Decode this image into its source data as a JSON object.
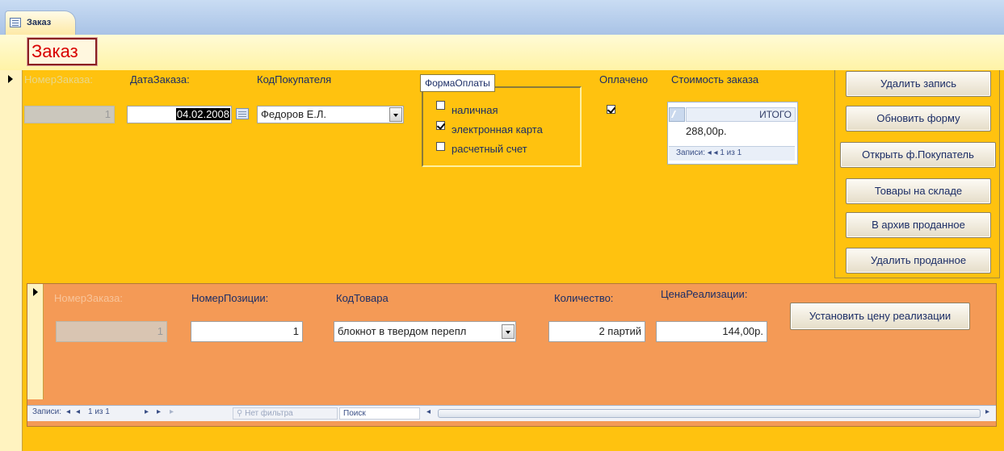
{
  "tab": {
    "label": "Заказ"
  },
  "form": {
    "title": "Заказ"
  },
  "main": {
    "labels": {
      "order_number": "НомерЗаказа:",
      "order_date": "ДатаЗаказа:",
      "customer_code": "КодПокупателя",
      "payment_form": "ФормаОплаты",
      "paid": "Оплачено",
      "order_cost": "Стоимость заказа"
    },
    "values": {
      "order_number": "1",
      "order_date": "04.02.2008",
      "customer": "Федоров Е.Л.",
      "paid": true
    },
    "payment_options": [
      {
        "label": "наличная",
        "checked": false
      },
      {
        "label": "электронная карта",
        "checked": true
      },
      {
        "label": "расчетный счет",
        "checked": false
      }
    ],
    "total_subform": {
      "header": "ИТОГО",
      "value": "288,00р.",
      "nav": "Записи: ◂ ◂ 1 из 1"
    }
  },
  "buttons": {
    "delete_record": "Удалить запись",
    "refresh_form": "Обновить форму",
    "open_customer": "Открыть ф.Покупатель",
    "warehouse": "Товары на складе",
    "archive_sold": "В архив проданное",
    "delete_sold": "Удалить проданное"
  },
  "subform": {
    "labels": {
      "order_number": "НомерЗаказа:",
      "position_number": "НомерПозиции:",
      "product_code": "КодТовара",
      "quantity": "Количество:",
      "sale_price": "ЦенаРеализации:"
    },
    "values": {
      "order_number": "1",
      "position_number": "1",
      "product": "блокнот в твердом перепл",
      "quantity": "2 партий",
      "sale_price": "144,00р."
    },
    "set_price_button": "Установить цену реализации",
    "nav": {
      "records_label": "Записи:",
      "first": "◂",
      "prev": "◂",
      "position": "1 из 1",
      "next": "▸",
      "last": "▸",
      "new": "▸",
      "filter": "Нет фильтра",
      "search": "Поиск"
    }
  },
  "colors": {
    "detail_bg": "#ffc20f",
    "subform_bg": "#f49a56",
    "header_bg": "#fff3a6",
    "title_red": "#d80000"
  }
}
